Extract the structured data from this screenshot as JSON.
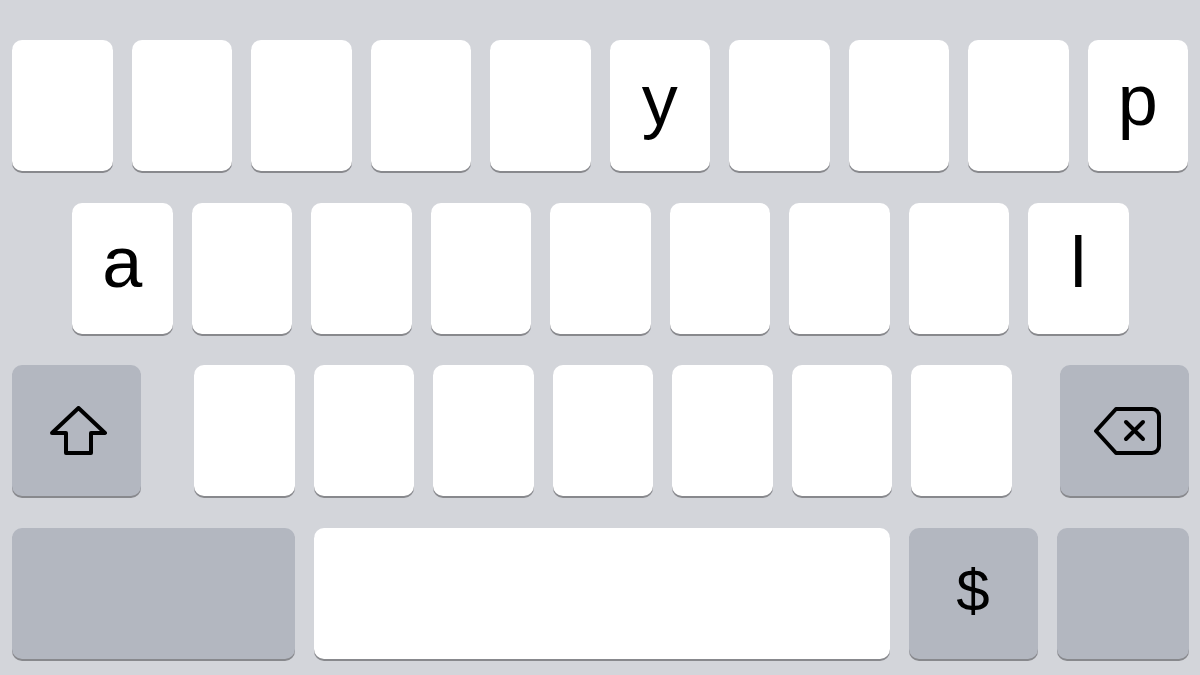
{
  "keyboard": {
    "rows": [
      {
        "keys": [
          {
            "kind": "letter"
          },
          {
            "kind": "letter"
          },
          {
            "kind": "letter"
          },
          {
            "kind": "letter"
          },
          {
            "kind": "letter"
          },
          {
            "kind": "letter",
            "label": "y"
          },
          {
            "kind": "letter"
          },
          {
            "kind": "letter"
          },
          {
            "kind": "letter"
          },
          {
            "kind": "letter",
            "label": "p"
          }
        ]
      },
      {
        "keys": [
          {
            "kind": "letter",
            "label": "a"
          },
          {
            "kind": "letter"
          },
          {
            "kind": "letter"
          },
          {
            "kind": "letter"
          },
          {
            "kind": "letter"
          },
          {
            "kind": "letter"
          },
          {
            "kind": "letter"
          },
          {
            "kind": "letter"
          },
          {
            "kind": "letter",
            "label": "l"
          }
        ]
      },
      {
        "keys": [
          {
            "kind": "shift",
            "on": false
          },
          {
            "kind": "letter"
          },
          {
            "kind": "letter"
          },
          {
            "kind": "letter"
          },
          {
            "kind": "letter"
          },
          {
            "kind": "letter"
          },
          {
            "kind": "letter"
          },
          {
            "kind": "letter"
          },
          {
            "kind": "backspace"
          }
        ]
      },
      {
        "keys": [
          {
            "kind": "modifier"
          },
          {
            "kind": "space"
          },
          {
            "kind": "symbol",
            "label": "$"
          },
          {
            "kind": "action"
          }
        ]
      }
    ]
  }
}
